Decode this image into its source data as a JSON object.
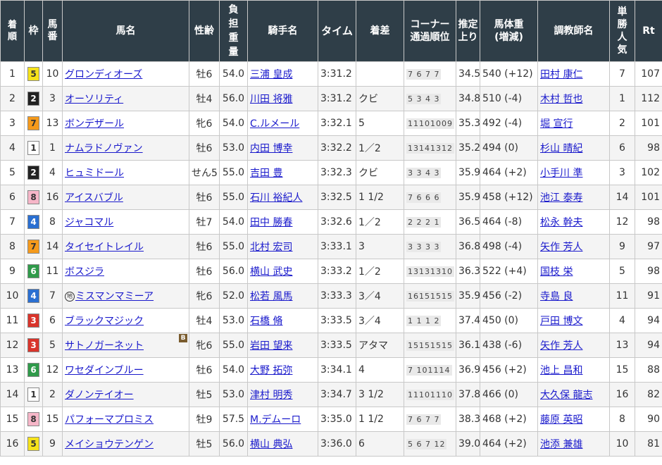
{
  "headers": {
    "rank": "着順",
    "waku": "枠",
    "umaban": "馬番",
    "horse": "馬名",
    "sexage": "性齢",
    "weight": "負担重量",
    "jockey": "騎手名",
    "time": "タイム",
    "margin": "着差",
    "corner": "コーナー通過順位",
    "last3f": "推定上り",
    "bodyweight": "馬体重(増減)",
    "trainer": "調教師名",
    "odds_pop": "単勝人気",
    "rt": "Rt"
  },
  "waku_colors": {
    "1": {
      "bg": "#ffffff",
      "fg": "#333333"
    },
    "2": {
      "bg": "#222222",
      "fg": "#ffffff"
    },
    "3": {
      "bg": "#d9342b",
      "fg": "#ffffff"
    },
    "4": {
      "bg": "#2a6fd1",
      "fg": "#ffffff"
    },
    "5": {
      "bg": "#f5e21a",
      "fg": "#333333"
    },
    "6": {
      "bg": "#2f9a4a",
      "fg": "#ffffff"
    },
    "7": {
      "bg": "#f59a1c",
      "fg": "#333333"
    },
    "8": {
      "bg": "#f6b6c8",
      "fg": "#333333"
    }
  },
  "rows": [
    {
      "rank": "1",
      "waku": "5",
      "umaban": "10",
      "horse": "グロンディオーズ",
      "prefix": "",
      "badge": "",
      "sexage": "牡6",
      "weight": "54.0",
      "jockey": "三浦 皇成",
      "time": "3:31.2",
      "margin": "",
      "corner": "7 6 7 7",
      "last3f": "34.5",
      "bodyweight": "540 (+12)",
      "trainer": "田村 康仁",
      "pop": "7",
      "rt": "107"
    },
    {
      "rank": "2",
      "waku": "2",
      "umaban": "3",
      "horse": "オーソリティ",
      "prefix": "",
      "badge": "",
      "sexage": "牡4",
      "weight": "56.0",
      "jockey": "川田 将雅",
      "time": "3:31.2",
      "margin": "クビ",
      "corner": "5 3 4 3",
      "last3f": "34.8",
      "bodyweight": "510 (-4)",
      "trainer": "木村 哲也",
      "pop": "1",
      "rt": "112"
    },
    {
      "rank": "3",
      "waku": "7",
      "umaban": "13",
      "horse": "ボンデザール",
      "prefix": "",
      "badge": "",
      "sexage": "牝6",
      "weight": "54.0",
      "jockey": "C.ルメール",
      "time": "3:32.1",
      "margin": "5",
      "corner": "11101009",
      "last3f": "35.3",
      "bodyweight": "492 (-4)",
      "trainer": "堀 宣行",
      "pop": "2",
      "rt": "101"
    },
    {
      "rank": "4",
      "waku": "1",
      "umaban": "1",
      "horse": "ナムラドノヴァン",
      "prefix": "",
      "badge": "",
      "sexage": "牡6",
      "weight": "53.0",
      "jockey": "内田 博幸",
      "time": "3:32.2",
      "margin": "1／2",
      "corner": "13141312",
      "last3f": "35.2",
      "bodyweight": "494 (0)",
      "trainer": "杉山 晴紀",
      "pop": "6",
      "rt": "98"
    },
    {
      "rank": "5",
      "waku": "2",
      "umaban": "4",
      "horse": "ヒュミドール",
      "prefix": "",
      "badge": "",
      "sexage": "せん5",
      "weight": "55.0",
      "jockey": "吉田 豊",
      "time": "3:32.3",
      "margin": "クビ",
      "corner": "3 3 4 3",
      "last3f": "35.9",
      "bodyweight": "464 (+2)",
      "trainer": "小手川 準",
      "pop": "3",
      "rt": "102"
    },
    {
      "rank": "6",
      "waku": "8",
      "umaban": "16",
      "horse": "アイスバブル",
      "prefix": "",
      "badge": "",
      "sexage": "牡6",
      "weight": "55.0",
      "jockey": "石川 裕紀人",
      "time": "3:32.5",
      "margin": "1 1/2",
      "corner": "7 6 6 6",
      "last3f": "35.9",
      "bodyweight": "458 (+12)",
      "trainer": "池江 泰寿",
      "pop": "14",
      "rt": "101"
    },
    {
      "rank": "7",
      "waku": "4",
      "umaban": "8",
      "horse": "ジャコマル",
      "prefix": "",
      "badge": "",
      "sexage": "牡7",
      "weight": "54.0",
      "jockey": "田中 勝春",
      "time": "3:32.6",
      "margin": "1／2",
      "corner": "2 2 2 1",
      "last3f": "36.5",
      "bodyweight": "464 (-8)",
      "trainer": "松永 幹夫",
      "pop": "12",
      "rt": "98"
    },
    {
      "rank": "8",
      "waku": "7",
      "umaban": "14",
      "horse": "タイセイトレイル",
      "prefix": "",
      "badge": "",
      "sexage": "牡6",
      "weight": "55.0",
      "jockey": "北村 宏司",
      "time": "3:33.1",
      "margin": "3",
      "corner": "3 3 3 3",
      "last3f": "36.8",
      "bodyweight": "498 (-4)",
      "trainer": "矢作 芳人",
      "pop": "9",
      "rt": "97"
    },
    {
      "rank": "9",
      "waku": "6",
      "umaban": "11",
      "horse": "ボスジラ",
      "prefix": "",
      "badge": "",
      "sexage": "牡6",
      "weight": "56.0",
      "jockey": "横山 武史",
      "time": "3:33.2",
      "margin": "1／2",
      "corner": "13131310",
      "last3f": "36.3",
      "bodyweight": "522 (+4)",
      "trainer": "国枝 栄",
      "pop": "5",
      "rt": "98"
    },
    {
      "rank": "10",
      "waku": "4",
      "umaban": "7",
      "horse": "ミスマンマミーア",
      "prefix": "地",
      "badge": "",
      "sexage": "牝6",
      "weight": "52.0",
      "jockey": "松若 風馬",
      "time": "3:33.3",
      "margin": "3／4",
      "corner": "16151515",
      "last3f": "35.9",
      "bodyweight": "456 (-2)",
      "trainer": "寺島 良",
      "pop": "11",
      "rt": "91"
    },
    {
      "rank": "11",
      "waku": "3",
      "umaban": "6",
      "horse": "ブラックマジック",
      "prefix": "",
      "badge": "",
      "sexage": "牡4",
      "weight": "53.0",
      "jockey": "石橋 脩",
      "time": "3:33.5",
      "margin": "3／4",
      "corner": "1 1 1 2",
      "last3f": "37.4",
      "bodyweight": "450 (0)",
      "trainer": "戸田 博文",
      "pop": "4",
      "rt": "94"
    },
    {
      "rank": "12",
      "waku": "3",
      "umaban": "5",
      "horse": "サトノガーネット",
      "prefix": "",
      "badge": "B",
      "sexage": "牝6",
      "weight": "55.0",
      "jockey": "岩田 望来",
      "time": "3:33.5",
      "margin": "アタマ",
      "corner": "15151515",
      "last3f": "36.1",
      "bodyweight": "438 (-6)",
      "trainer": "矢作 芳人",
      "pop": "13",
      "rt": "94"
    },
    {
      "rank": "13",
      "waku": "6",
      "umaban": "12",
      "horse": "ワセダインブルー",
      "prefix": "",
      "badge": "",
      "sexage": "牡6",
      "weight": "54.0",
      "jockey": "大野 拓弥",
      "time": "3:34.1",
      "margin": "4",
      "corner": "7 101114",
      "last3f": "36.9",
      "bodyweight": "456 (+2)",
      "trainer": "池上 昌和",
      "pop": "15",
      "rt": "88"
    },
    {
      "rank": "14",
      "waku": "1",
      "umaban": "2",
      "horse": "ダノンテイオー",
      "prefix": "",
      "badge": "",
      "sexage": "牡5",
      "weight": "53.0",
      "jockey": "津村 明秀",
      "time": "3:34.7",
      "margin": "3 1/2",
      "corner": "11101110",
      "last3f": "37.8",
      "bodyweight": "466 (0)",
      "trainer": "大久保 龍志",
      "pop": "16",
      "rt": "82"
    },
    {
      "rank": "15",
      "waku": "8",
      "umaban": "15",
      "horse": "パフォーマプロミス",
      "prefix": "",
      "badge": "",
      "sexage": "牡9",
      "weight": "57.5",
      "jockey": "M.デムーロ",
      "time": "3:35.0",
      "margin": "1 1/2",
      "corner": "7 6 7 7",
      "last3f": "38.3",
      "bodyweight": "468 (+2)",
      "trainer": "藤原 英昭",
      "pop": "8",
      "rt": "90"
    },
    {
      "rank": "16",
      "waku": "5",
      "umaban": "9",
      "horse": "メイショウテンゲン",
      "prefix": "",
      "badge": "",
      "sexage": "牡5",
      "weight": "56.0",
      "jockey": "横山 典弘",
      "time": "3:36.0",
      "margin": "6",
      "corner": "5 6 7 12",
      "last3f": "39.0",
      "bodyweight": "464 (+2)",
      "trainer": "池添 兼雄",
      "pop": "10",
      "rt": "81"
    }
  ]
}
